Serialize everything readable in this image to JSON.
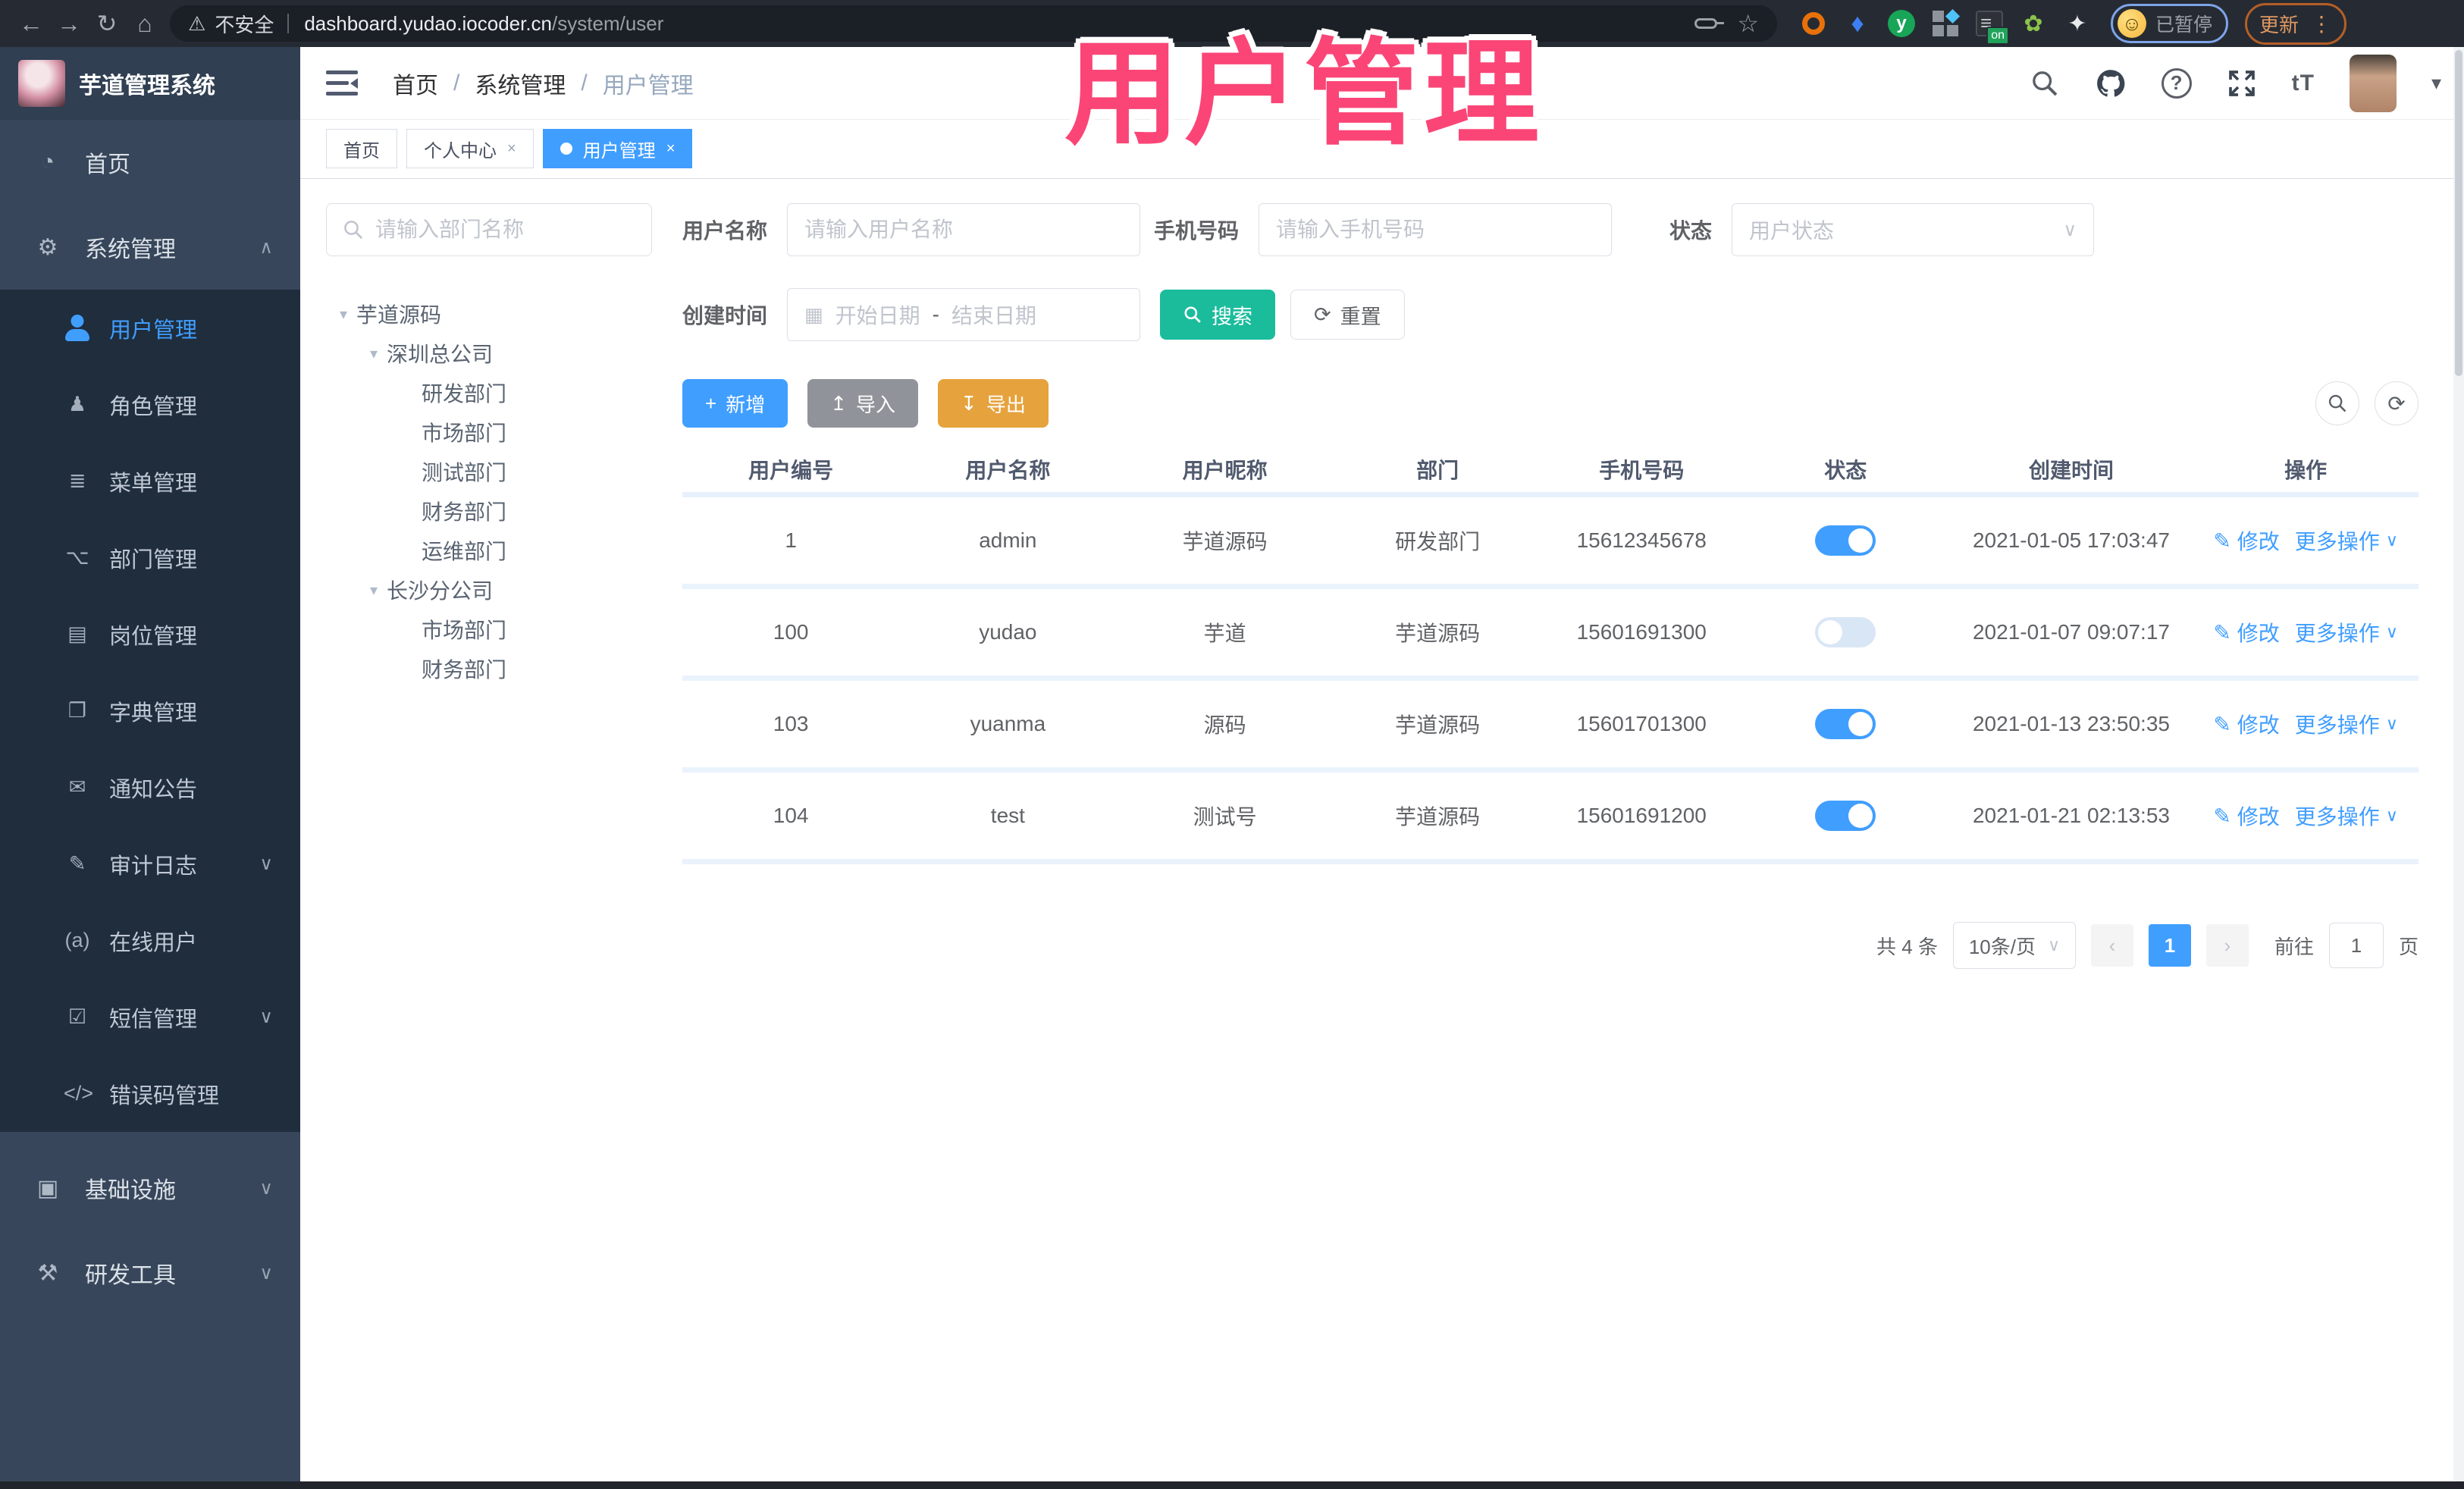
{
  "colors": {
    "accent": "#409eff",
    "search_button": "#1abc9c",
    "import_button": "#909399",
    "export_button": "#e6a23c",
    "overlay_pink": "#fb4576",
    "sidebar_bg": "#37465a",
    "submenu_bg": "#1f2d3d"
  },
  "icons": {
    "back": "←",
    "forward": "→",
    "reload": "↻",
    "home": "⌂",
    "warning": "⚠",
    "star": "☆",
    "kebab": "⋮",
    "dashboard": "◔",
    "gear": "⚙",
    "roles": "♟",
    "menu": "≣",
    "dept": "⌥",
    "post": "▤",
    "dict": "❐",
    "notice": "✉",
    "audit": "✎",
    "online": "(a)",
    "sms": "☑",
    "errcode": "</>",
    "infra": "▣",
    "devtools": "⚒",
    "chevron_up": "∧",
    "chevron_down": "∨",
    "caret": "▾",
    "plus": "+",
    "upload": "↥",
    "download": "↧",
    "refresh": "⟳",
    "edit": "✎",
    "calendar": "▦",
    "font_size": "tT",
    "smile": "☺",
    "gem": "♦",
    "leaf": "✿",
    "puzzle": "✦",
    "question": "?",
    "g_letter": "y"
  },
  "browser": {
    "security": "不安全",
    "host": "dashboard.yudao.iocoder.cn",
    "path": "/system/user",
    "paused_badge": "已暂停",
    "update": "更新"
  },
  "overlay_title": "用户管理",
  "sidebar": {
    "title": "芋道管理系统",
    "home": "首页",
    "system": "系统管理",
    "infra": "基础设施",
    "devtools": "研发工具",
    "sub": [
      "用户管理",
      "角色管理",
      "菜单管理",
      "部门管理",
      "岗位管理",
      "字典管理",
      "通知公告",
      "审计日志",
      "在线用户",
      "短信管理",
      "错误码管理"
    ]
  },
  "breadcrumb": [
    "首页",
    "系统管理",
    "用户管理"
  ],
  "tabs": {
    "home": "首页",
    "profile": "个人中心",
    "user": "用户管理"
  },
  "tree": {
    "search_placeholder": "请输入部门名称",
    "items": [
      {
        "label": "芋道源码"
      },
      {
        "label": "深圳总公司"
      },
      {
        "label": "研发部门"
      },
      {
        "label": "市场部门"
      },
      {
        "label": "测试部门"
      },
      {
        "label": "财务部门"
      },
      {
        "label": "运维部门"
      },
      {
        "label": "长沙分公司"
      },
      {
        "label": "市场部门"
      },
      {
        "label": "财务部门"
      }
    ]
  },
  "filters": {
    "username_label": "用户名称",
    "username_placeholder": "请输入用户名称",
    "mobile_label": "手机号码",
    "mobile_placeholder": "请输入手机号码",
    "status_label": "状态",
    "status_placeholder": "用户状态",
    "created_label": "创建时间",
    "date_start": "开始日期",
    "date_separator": "-",
    "date_end": "结束日期",
    "search": "搜索",
    "reset": "重置"
  },
  "toolbar": {
    "add": "新增",
    "import": "导入",
    "export": "导出"
  },
  "table": {
    "columns": [
      "用户编号",
      "用户名称",
      "用户昵称",
      "部门",
      "手机号码",
      "状态",
      "创建时间",
      "操作"
    ],
    "action_edit": "修改",
    "action_more": "更多操作",
    "rows": [
      {
        "id": "1",
        "username": "admin",
        "nickname": "芋道源码",
        "dept": "研发部门",
        "mobile": "15612345678",
        "status": true,
        "created": "2021-01-05 17:03:47"
      },
      {
        "id": "100",
        "username": "yudao",
        "nickname": "芋道",
        "dept": "芋道源码",
        "mobile": "15601691300",
        "status": false,
        "created": "2021-01-07 09:07:17"
      },
      {
        "id": "103",
        "username": "yuanma",
        "nickname": "源码",
        "dept": "芋道源码",
        "mobile": "15601701300",
        "status": true,
        "created": "2021-01-13 23:50:35"
      },
      {
        "id": "104",
        "username": "test",
        "nickname": "测试号",
        "dept": "芋道源码",
        "mobile": "15601691200",
        "status": true,
        "created": "2021-01-21 02:13:53"
      }
    ]
  },
  "pagination": {
    "total": "共 4 条",
    "page_size": "10条/页",
    "page": "1",
    "goto": "前往",
    "goto_value": "1",
    "unit": "页"
  }
}
